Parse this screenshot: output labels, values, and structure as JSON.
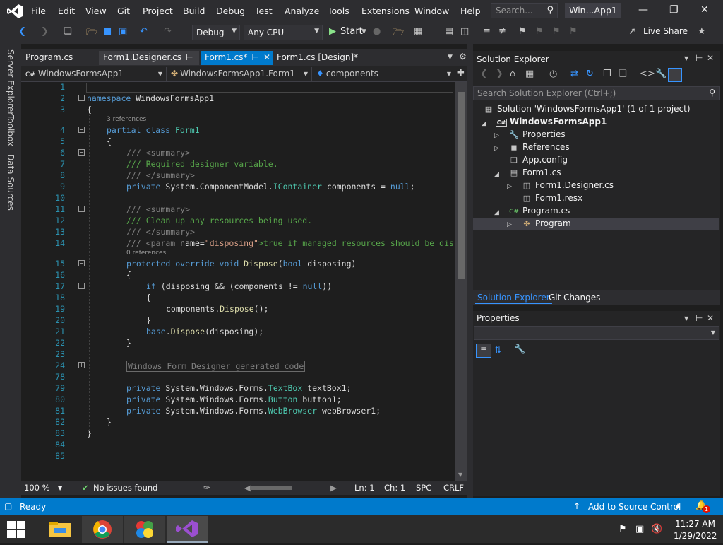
{
  "menu": [
    "File",
    "Edit",
    "View",
    "Git",
    "Project",
    "Build",
    "Debug",
    "Test",
    "Analyze",
    "Tools",
    "Extensions",
    "Window",
    "Help"
  ],
  "search": {
    "placeholder": "Search..."
  },
  "window_title": "Win...App1",
  "toolbar": {
    "config": "Debug",
    "platform": "Any CPU",
    "start": "Start",
    "live_share": "Live Share"
  },
  "side_tabs": [
    "Server Explorer",
    "Toolbox",
    "Data Sources"
  ],
  "tabs": [
    {
      "label": "Program.cs"
    },
    {
      "label": "Form1.Designer.cs"
    },
    {
      "label": "Form1.cs*"
    },
    {
      "label": "Form1.cs [Design]*"
    }
  ],
  "navbar": {
    "project": "WindowsFormsApp1",
    "class": "WindowsFormsApp1.Form1",
    "member": "components"
  },
  "code": {
    "ref3": "3 references",
    "ref0": "0 references",
    "lines": {
      "l2_ns": "namespace",
      "l2_name": " WindowsFormsApp1",
      "l3": "{",
      "l4_a": "partial class",
      "l4_b": " Form1",
      "l5": "{",
      "l6": "/// <summary>",
      "l7": "/// Required designer variable.",
      "l8": "/// </summary>",
      "l9_a": "private",
      "l9_b": " System.ComponentModel.",
      "l9_c": "IContainer",
      "l9_d": " components = ",
      "l9_e": "null",
      "l9_f": ";",
      "l11": "/// <summary>",
      "l12": "/// Clean up any resources being used.",
      "l13": "/// </summary>",
      "l14_a": "/// <param ",
      "l14_b": "name=",
      "l14_c": "\"disposing\"",
      "l14_d": ">true if managed resources should be dis",
      "l15_a": "protected override void",
      "l15_b": " Dispose",
      "l15_c": "(",
      "l15_d": "bool",
      "l15_e": " disposing)",
      "l16": "{",
      "l17_a": "if",
      "l17_b": " (disposing && (components != ",
      "l17_c": "null",
      "l17_d": "))",
      "l18": "{",
      "l19_a": "components.",
      "l19_b": "Dispose",
      "l19_c": "();",
      "l20": "}",
      "l21_a": "base",
      "l21_b": ".",
      "l21_c": "Dispose",
      "l21_d": "(disposing);",
      "l22": "}",
      "l24": "Windows Form Designer generated code",
      "l79_a": "private",
      "l79_b": " System.Windows.Forms.",
      "l79_c": "TextBox",
      "l79_d": " textBox1;",
      "l80_a": "private",
      "l80_b": " System.Windows.Forms.",
      "l80_c": "Button",
      "l80_d": " button1;",
      "l81_a": "private",
      "l81_b": " System.Windows.Forms.",
      "l81_c": "WebBrowser",
      "l81_d": " webBrowser1;",
      "l82": "}",
      "l83": "}"
    },
    "line_numbers": [
      "1",
      "2",
      "3",
      "4",
      "5",
      "6",
      "7",
      "8",
      "9",
      "10",
      "11",
      "12",
      "13",
      "14",
      "15",
      "16",
      "17",
      "18",
      "19",
      "20",
      "21",
      "22",
      "23",
      "24",
      "78",
      "79",
      "80",
      "81",
      "82",
      "83",
      "84",
      "85"
    ]
  },
  "editor_status": {
    "zoom": "100 %",
    "issues": "No issues found",
    "ln": "Ln: 1",
    "ch": "Ch: 1",
    "spc": "SPC",
    "crlf": "CRLF"
  },
  "solution_explorer": {
    "title": "Solution Explorer",
    "search_placeholder": "Search Solution Explorer (Ctrl+;)",
    "items": [
      {
        "label": "Solution 'WindowsFormsApp1' (1 of 1 project)"
      },
      {
        "label": "WindowsFormsApp1"
      },
      {
        "label": "Properties"
      },
      {
        "label": "References"
      },
      {
        "label": "App.config"
      },
      {
        "label": "Form1.cs"
      },
      {
        "label": "Form1.Designer.cs"
      },
      {
        "label": "Form1.resx"
      },
      {
        "label": "Program.cs"
      },
      {
        "label": "Program"
      }
    ]
  },
  "panel_tabs": [
    "Solution Explorer",
    "Git Changes"
  ],
  "properties": {
    "title": "Properties"
  },
  "status": {
    "ready": "Ready",
    "source_control": "Add to Source Control",
    "notif_count": "1"
  },
  "taskbar": {
    "time": "11:27 AM",
    "date": "1/29/2022"
  }
}
